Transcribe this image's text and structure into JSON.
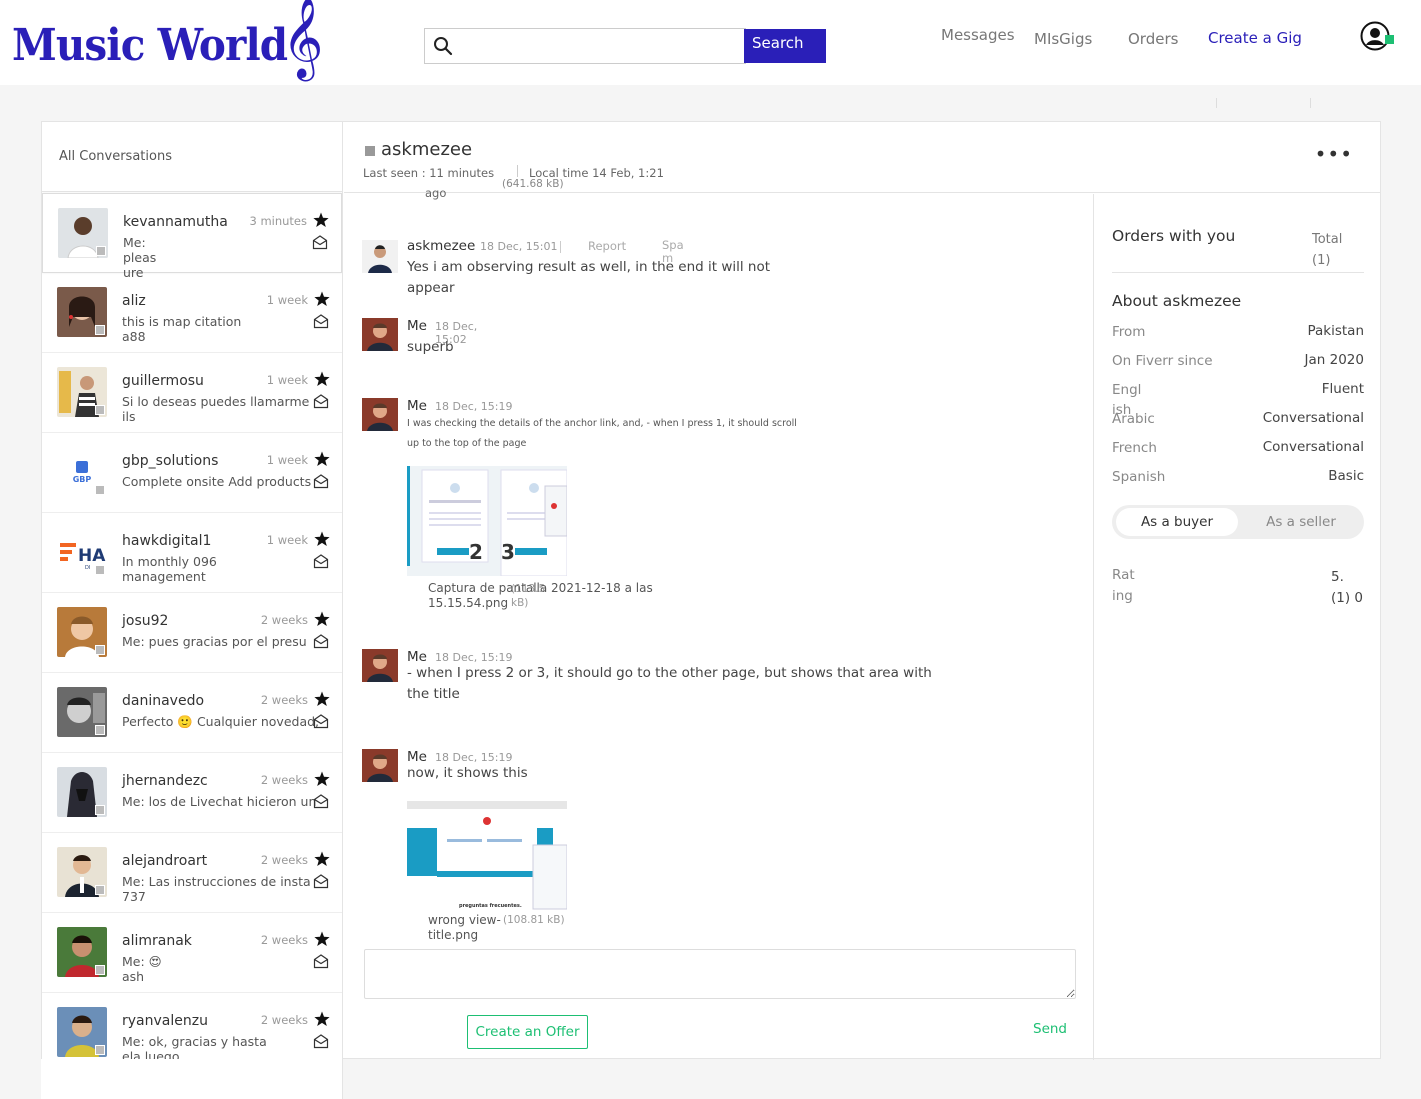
{
  "header": {
    "logo": "Music World",
    "search": {
      "placeholder": "",
      "button": "Search"
    },
    "nav": {
      "messages": "Messages",
      "mygigs": "MIsGigs",
      "orders": "Orders",
      "create_gig": "Create a Gig"
    },
    "colors": {
      "brand": "#2a1fb8",
      "online": "#1dbf73"
    }
  },
  "sidebar": {
    "title": "All Conversations",
    "conversations": [
      {
        "user": "kevannamutha",
        "time": "3 minutes",
        "preview": "Me: pleas                              ure"
      },
      {
        "user": "aliz",
        "time": "1 week",
        "preview": "this is map citation a88"
      },
      {
        "user": "guillermosu",
        "time": "1 week",
        "preview": "Si lo deseas puedes llamarme ils"
      },
      {
        "user": "gbp_solutions",
        "time": "1 week",
        "preview": "Complete onsite Add products"
      },
      {
        "user": "hawkdigital1",
        "time": "1 week",
        "preview": "In monthly 096 management"
      },
      {
        "user": "josu92",
        "time": "2 weeks",
        "preview": "Me: pues gracias por el presu"
      },
      {
        "user": "daninavedo",
        "time": "2 weeks",
        "preview": "Perfecto 🙂 Cualquier novedad,"
      },
      {
        "user": "jhernandezc",
        "time": "2 weeks",
        "preview": "Me: los de Livechat hicieron un"
      },
      {
        "user": "alejandroart",
        "time": "2 weeks",
        "preview": "Me: Las instrucciones de insta 737"
      },
      {
        "user": "alimranak",
        "time": "2 weeks",
        "preview": "Me: 😍 ash"
      },
      {
        "user": "ryanvalenzu",
        "time": "2 weeks",
        "preview": "Me: ok, gracias y hasta ela luego"
      }
    ]
  },
  "chat": {
    "name": "askmezee",
    "last_seen": "Last seen : 11 minutes",
    "ago": "ago",
    "local_time": "Local time 14 Feb, 1:21",
    "top_size": "(641.68 kB)",
    "messages": [
      {
        "sender": "askmezee",
        "time": "18 Dec, 15:01",
        "report": "Report",
        "spam": "Spa m",
        "text": "Yes i am observing result as well, in the end it will not appear"
      },
      {
        "sender": "Me",
        "time": "18 Dec, 15:02",
        "text": "superb"
      },
      {
        "sender": "Me",
        "time": "18 Dec, 15:19",
        "text": "I was checking the details of the anchor link, and, - when I press 1, it should scroll up to the top of the page",
        "attachment": {
          "name": "Captura de pantalla 2021-12-18 a las 15.15.54.png",
          "size": "(113.5 kB)"
        }
      },
      {
        "sender": "Me",
        "time": "18 Dec, 15:19",
        "text": "- when I press 2 or 3, it should go to the other page, but shows that area with the title"
      },
      {
        "sender": "Me",
        "time": "18 Dec, 15:19",
        "text": "now, it shows this",
        "attachment": {
          "name": "wrong view-title.png",
          "size": "(108.81 kB)"
        }
      }
    ],
    "compose_placeholder": "",
    "offer_button": "Create an Offer",
    "send": "Send"
  },
  "details": {
    "orders_title": "Orders with you",
    "total": "Total (1)",
    "about_title": "About askmezee",
    "fields": [
      {
        "k": "From",
        "v": "Pakistan"
      },
      {
        "k": "On Fiverr since",
        "v": "Jan 2020"
      },
      {
        "k": "Engl ish",
        "v": "Fluent"
      },
      {
        "k": "Arabic",
        "v": "Conversational"
      },
      {
        "k": "French",
        "v": "Conversational"
      },
      {
        "k": "Spanish",
        "v": "Basic"
      }
    ],
    "toggle": {
      "buyer": "As a buyer",
      "seller": "As a seller"
    },
    "rating_label": "Rat ing",
    "rating_value": "5. (1) 0"
  }
}
